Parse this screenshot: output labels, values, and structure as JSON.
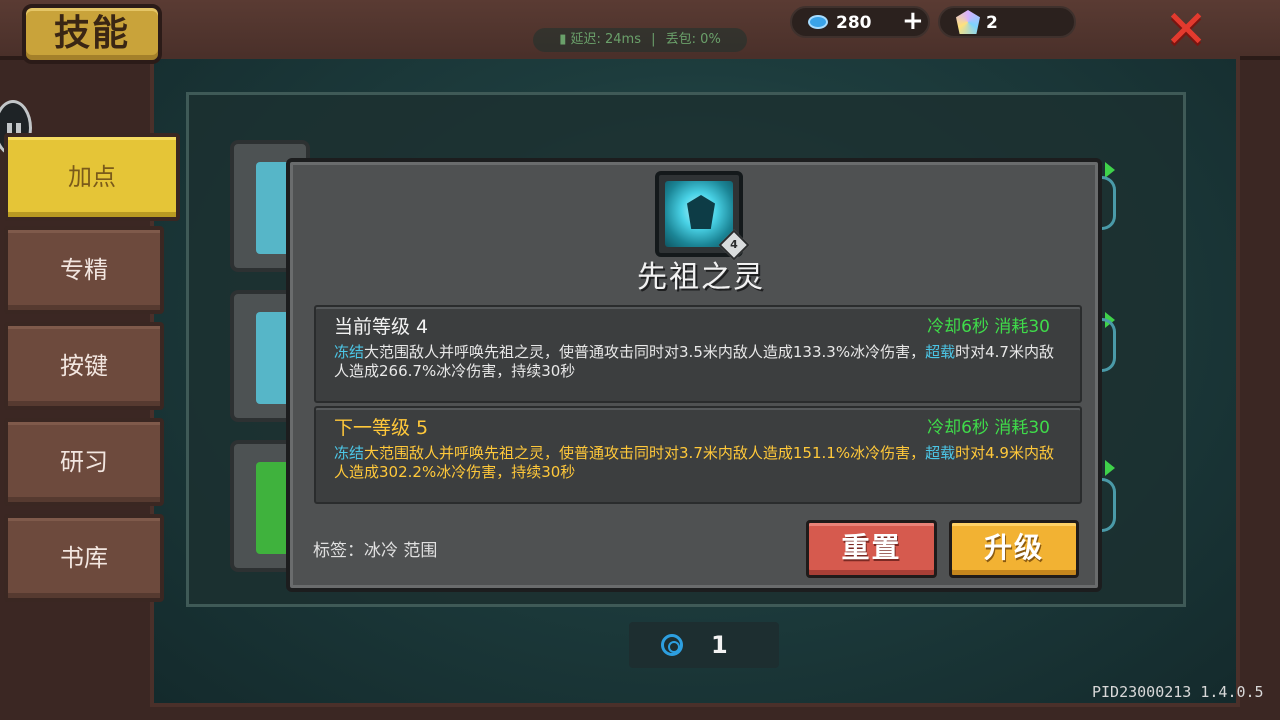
{
  "header": {
    "title": "技能",
    "latency_label": "延迟: 24ms",
    "packet_loss_label": "丢包: 0%",
    "gems": "280",
    "crystals": "2"
  },
  "tabs": [
    {
      "label": "加点",
      "active": true
    },
    {
      "label": "专精",
      "active": false
    },
    {
      "label": "按键",
      "active": false
    },
    {
      "label": "研习",
      "active": false
    },
    {
      "label": "书库",
      "active": false
    }
  ],
  "skill": {
    "level_badge": "4",
    "name": "先祖之灵",
    "current": {
      "title": "当前等级 4",
      "meta": "冷却6秒 消耗30",
      "desc_kw1": "冻结",
      "desc_text1": "大范围敌人并呼唤先祖之灵，使普通攻击同时对3.5米内敌人造成133.3%冰冷伤害，",
      "desc_kw2": "超载",
      "desc_text2": "时对4.7米内敌人造成266.7%冰冷伤害，持续30秒"
    },
    "next": {
      "title": "下一等级 5",
      "meta": "冷却6秒 消耗30",
      "desc_kw1": "冻结",
      "desc_text1": "大范围敌人并呼唤先祖之灵，使普通攻击同时对3.7米内敌人造成151.1%冰冷伤害，",
      "desc_kw2": "超载",
      "desc_text2": "时对4.9米内敌人造成302.2%冰冷伤害，持续30秒"
    },
    "tags_label": "标签：冰冷 范围",
    "reset_label": "重置",
    "upgrade_label": "升级"
  },
  "pager": {
    "page": "1"
  },
  "build_id": "PID23000213 1.4.0.5",
  "colors": {
    "accent_yellow": "#e5c537",
    "cooldown_green": "#3fdc4a",
    "keyword_cyan": "#4cc6e6",
    "next_level_gold": "#ffc83a",
    "reset_red": "#d65a4e",
    "upgrade_orange": "#f2b233",
    "close_red": "#e33a2e"
  },
  "icons": [
    "gem-icon",
    "plus-icon",
    "crystal-icon",
    "close-icon",
    "chat-icon",
    "skill-icon",
    "spiral-icon",
    "signal-icon"
  ]
}
